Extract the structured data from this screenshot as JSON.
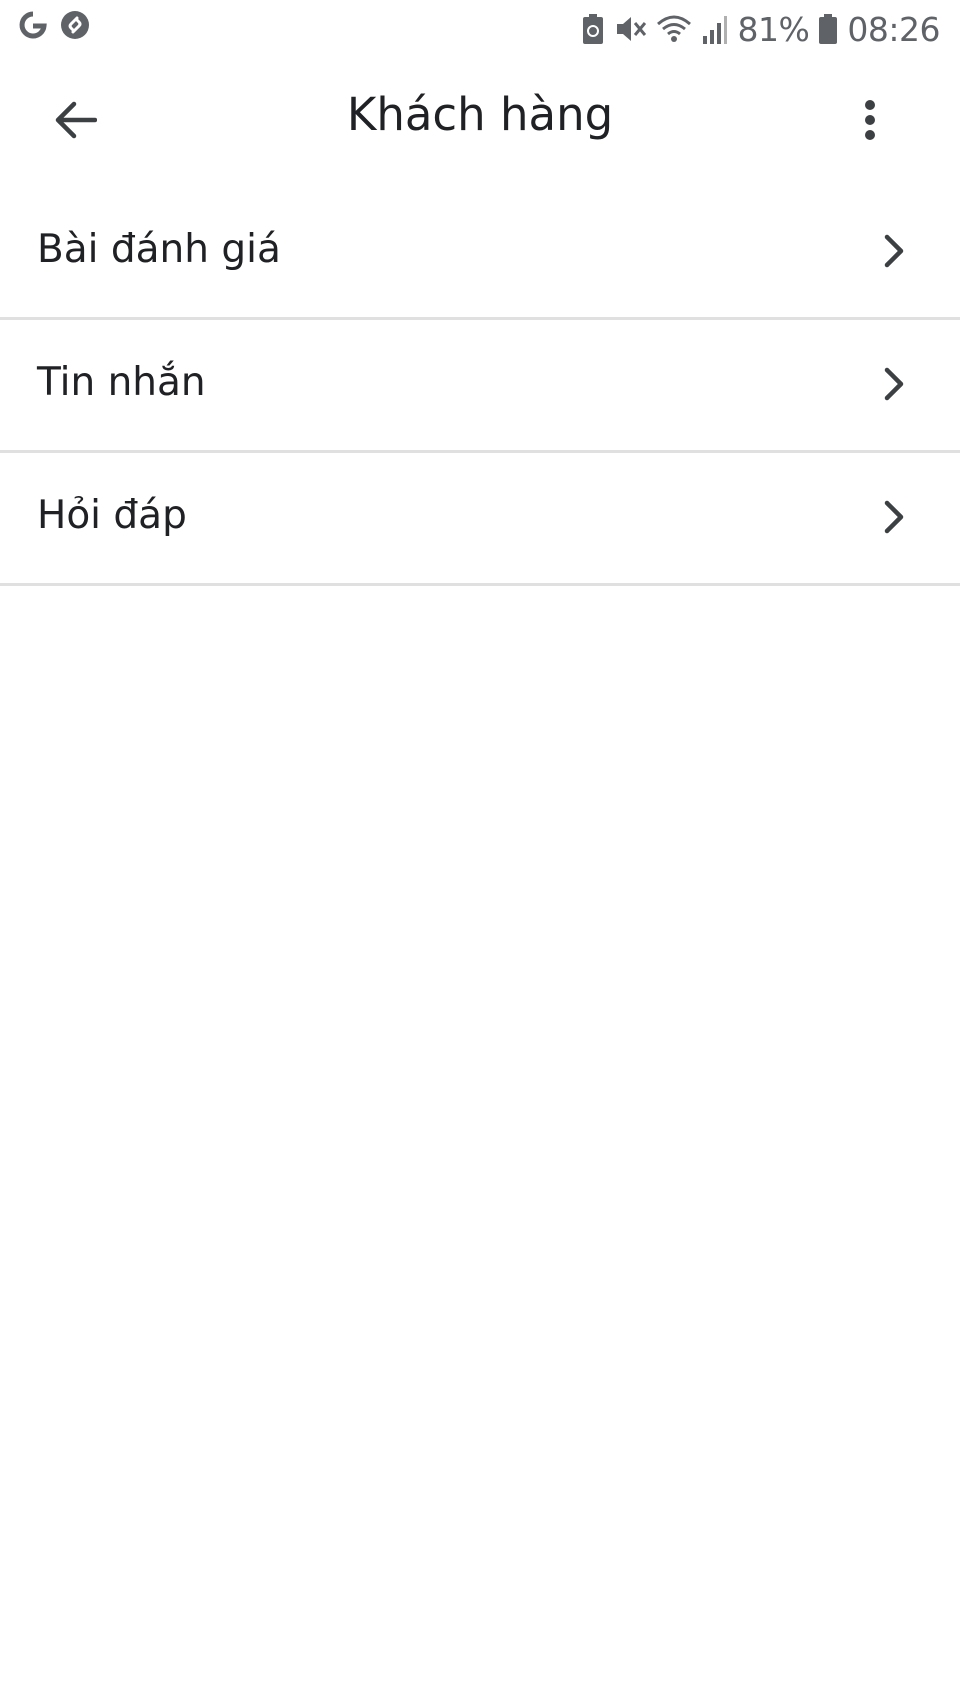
{
  "status_bar": {
    "left_icons": [
      "google-g-icon",
      "shazam-icon"
    ],
    "right_icons": [
      "battery-saver-icon",
      "vibrate-mute-icon",
      "wifi-icon",
      "signal-icon",
      "battery-icon"
    ],
    "battery_percent": "81%",
    "time": "08:26"
  },
  "app_bar": {
    "title": "Khách hàng",
    "back_icon": "arrow-back-icon",
    "more_icon": "more-vert-icon"
  },
  "menu": {
    "items": [
      {
        "label": "Bài đánh giá",
        "icon": "chevron-right-icon"
      },
      {
        "label": "Tin nhắn",
        "icon": "chevron-right-icon"
      },
      {
        "label": "Hỏi đáp",
        "icon": "chevron-right-icon"
      }
    ]
  },
  "colors": {
    "background": "#ffffff",
    "text": "#202124",
    "icon": "#3c4043",
    "divider": "#e0e0e0",
    "status": "#5f6368"
  }
}
